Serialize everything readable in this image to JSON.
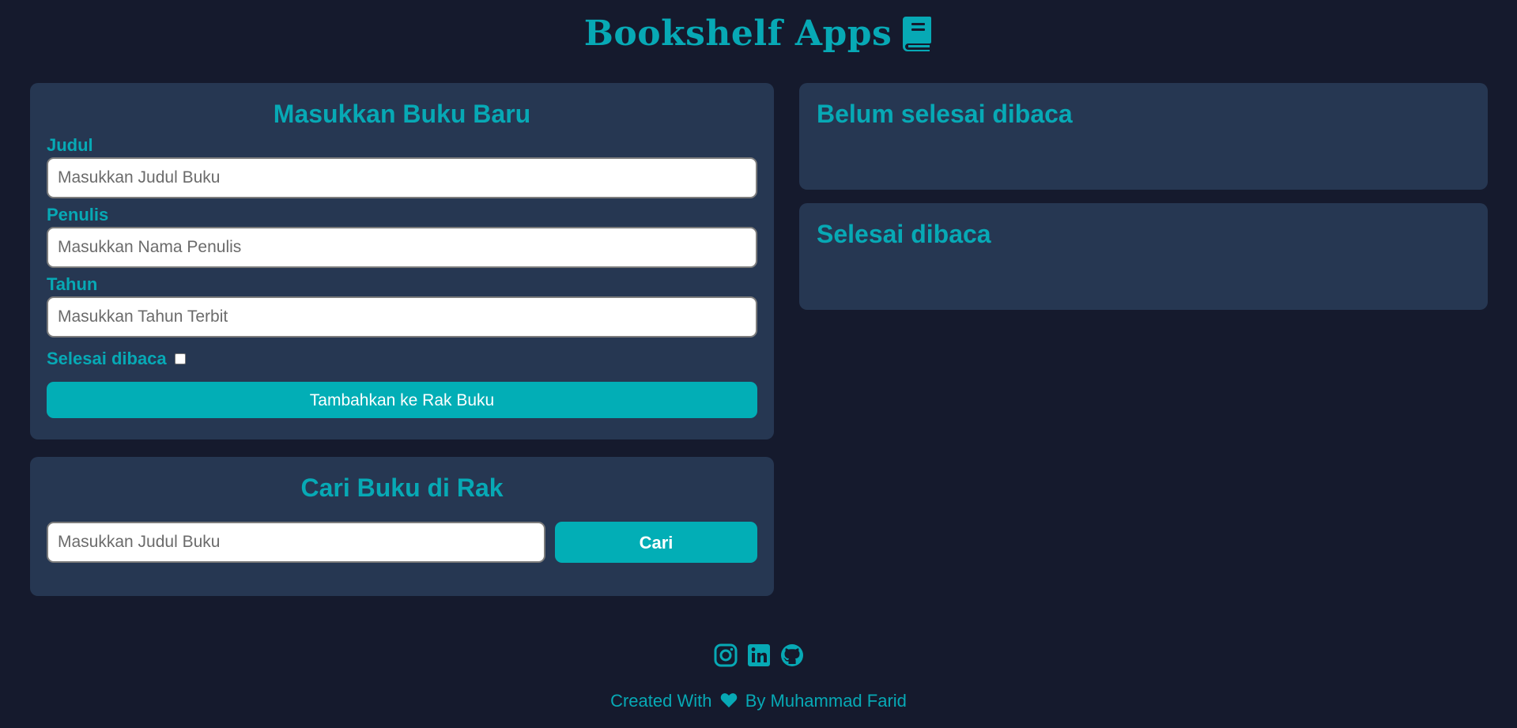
{
  "header": {
    "title": "Bookshelf Apps",
    "icon": "book-icon"
  },
  "input_section": {
    "title": "Masukkan Buku Baru",
    "fields": {
      "title_label": "Judul",
      "title_placeholder": "Masukkan Judul Buku",
      "author_label": "Penulis",
      "author_placeholder": "Masukkan Nama Penulis",
      "year_label": "Tahun",
      "year_placeholder": "Masukkan Tahun Terbit",
      "complete_label": "Selesai dibaca",
      "complete_checked": false
    },
    "submit_label": "Tambahkan ke Rak Buku"
  },
  "search_section": {
    "title": "Cari Buku di Rak",
    "placeholder": "Masukkan Judul Buku",
    "button_label": "Cari"
  },
  "shelves": {
    "unread_title": "Belum selesai dibaca",
    "read_title": "Selesai dibaca"
  },
  "social": [
    "instagram-icon",
    "linkedin-icon",
    "github-icon"
  ],
  "footer": {
    "created_with": "Created With",
    "by": "By Muhammad Farid"
  },
  "colors": {
    "background": "#151a2d",
    "panel": "#263752",
    "accent": "#07a9b5",
    "button": "#02aeb6"
  }
}
